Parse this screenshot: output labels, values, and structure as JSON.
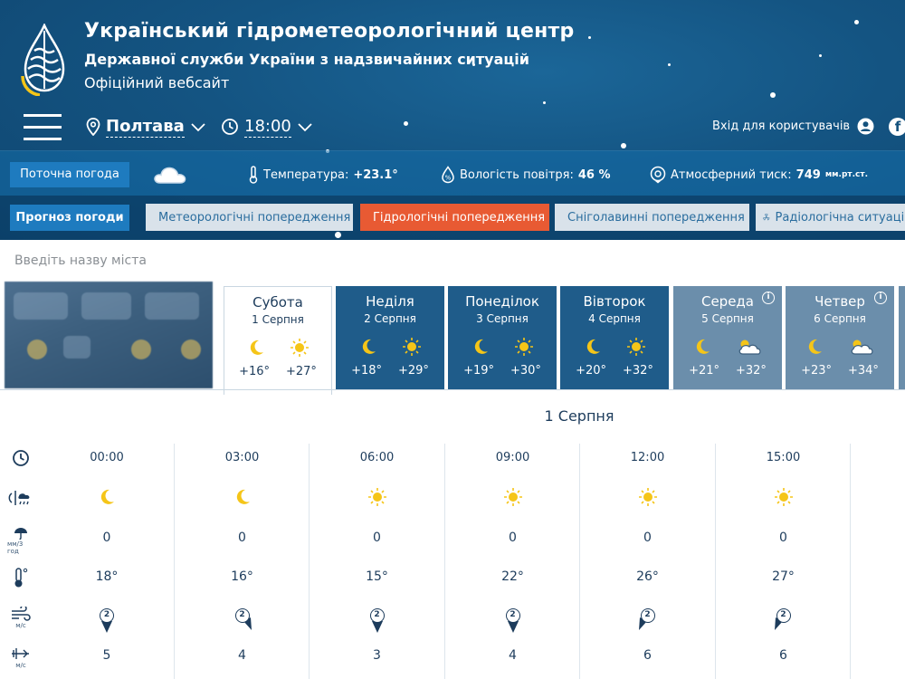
{
  "header": {
    "title_1": "Український гідрометеорологічний центр",
    "title_2": "Державної служби України з надзвичайних ситуацій",
    "title_3": "Офіційний вебсайт",
    "location": "Полтава",
    "time": "18:00",
    "login_label": "Вхід для користувачів",
    "facebook_label": "f"
  },
  "current": {
    "button_label": "Поточна погода",
    "temperature_label": "Температура:",
    "temperature_value": "+23.1°",
    "humidity_label": "Вологість повітря:",
    "humidity_value": "46 %",
    "pressure_label": "Атмосферний тиск:",
    "pressure_value": "749",
    "pressure_unit": "мм.рт.ст."
  },
  "forecast_bar": {
    "button_label": "Прогноз погоди",
    "warnings": [
      {
        "label": "Метеорологічні попередження",
        "active": false
      },
      {
        "label": "Гідрологічні попередження",
        "active": true
      },
      {
        "label": "Сніголавинні попередження",
        "active": false
      },
      {
        "label": "Радіологічна ситуація",
        "active": false
      }
    ]
  },
  "search": {
    "placeholder": "Введіть назву міста"
  },
  "days": [
    {
      "name": "Субота",
      "date": "1 Серпня",
      "night_icon": "moon-icon",
      "day_icon": "sun-icon",
      "night_temp": "+16°",
      "day_temp": "+27°",
      "info": false
    },
    {
      "name": "Неділя",
      "date": "2 Серпня",
      "night_icon": "moon-icon",
      "day_icon": "sun-icon",
      "night_temp": "+18°",
      "day_temp": "+29°",
      "info": false
    },
    {
      "name": "Понеділок",
      "date": "3 Серпня",
      "night_icon": "moon-icon",
      "day_icon": "sun-icon",
      "night_temp": "+19°",
      "day_temp": "+30°",
      "info": false
    },
    {
      "name": "Вівторок",
      "date": "4 Серпня",
      "night_icon": "moon-icon",
      "day_icon": "sun-icon",
      "night_temp": "+20°",
      "day_temp": "+32°",
      "info": false
    },
    {
      "name": "Середа",
      "date": "5 Серпня",
      "night_icon": "moon-icon",
      "day_icon": "cloud-sun-icon",
      "night_temp": "+21°",
      "day_temp": "+32°",
      "info": true
    },
    {
      "name": "Четвер",
      "date": "6 Серпня",
      "night_icon": "moon-icon",
      "day_icon": "cloud-sun-icon",
      "night_temp": "+23°",
      "day_temp": "+34°",
      "info": true
    }
  ],
  "detail": {
    "date_title": "1 Серпня",
    "precip_unit": "мм/3 год",
    "wind_unit": "м/с",
    "gust_unit": "м/с",
    "columns": [
      {
        "time": "00:00",
        "icon": "moon-icon",
        "precip": "0",
        "temp": "18°",
        "wind_dir": "2",
        "wind_speed": "5"
      },
      {
        "time": "03:00",
        "icon": "moon-icon",
        "precip": "0",
        "temp": "16°",
        "wind_dir": "2",
        "wind_speed": "4"
      },
      {
        "time": "06:00",
        "icon": "sun-icon",
        "precip": "0",
        "temp": "15°",
        "wind_dir": "2",
        "wind_speed": "3"
      },
      {
        "time": "09:00",
        "icon": "sun-icon",
        "precip": "0",
        "temp": "22°",
        "wind_dir": "2",
        "wind_speed": "4"
      },
      {
        "time": "12:00",
        "icon": "sun-icon",
        "precip": "0",
        "temp": "26°",
        "wind_dir": "2",
        "wind_speed": "6"
      },
      {
        "time": "15:00",
        "icon": "sun-icon",
        "precip": "0",
        "temp": "27°",
        "wind_dir": "2",
        "wind_speed": "6"
      }
    ]
  },
  "colors": {
    "header_bg": "#14527d",
    "button_blue": "#1e7bbf",
    "warning_active": "#e85a33",
    "day_dark": "#1f5c8a",
    "sun": "#f5c518"
  }
}
